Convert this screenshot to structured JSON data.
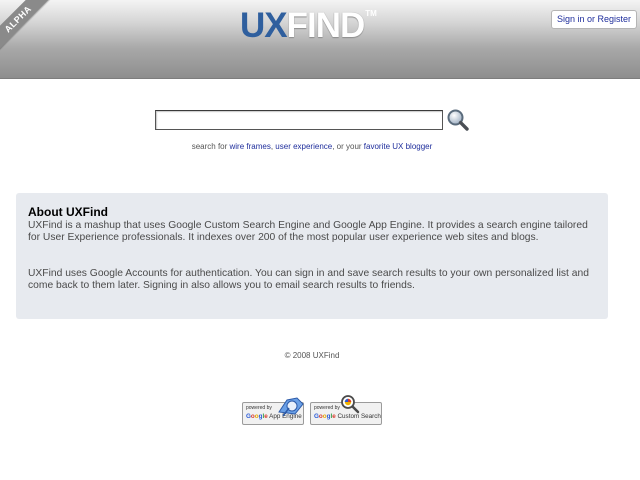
{
  "header": {
    "ribbon": "ALPHA",
    "logo_ux": "UX",
    "logo_find": "FIND",
    "logo_tm": "TM",
    "signin_label": "Sign in or Register"
  },
  "search": {
    "input_value": "",
    "hint_prefix": "search for ",
    "hint_link1": "wire frames",
    "hint_sep1": ", ",
    "hint_link2": "user experience",
    "hint_sep2": ", or your ",
    "hint_link3": "favorite UX blogger",
    "button_icon": "magnifier-icon"
  },
  "about": {
    "title": "About UXFind",
    "paragraph1": "UXFind is a mashup that uses Google Custom Search Engine and Google App Engine. It provides a search engine tailored for User Experience professionals. It indexes over 200 of the most popular user experience web sites and blogs.",
    "paragraph2": "UXFind uses Google Accounts for authentication. You can sign in and save search results to your own personalized list and come back to them later. Signing in also allows you to email search results to friends."
  },
  "footer": {
    "copyright": "© 2008 UXFind",
    "badge_appengine_powered": "powered by",
    "badge_appengine_name": "App Engine",
    "badge_cse_powered": "powered by",
    "badge_cse_name": "Custom Search",
    "google_g": "G",
    "google_o1": "o",
    "google_o2": "o",
    "google_g2": "g",
    "google_l": "l",
    "google_e": "e"
  },
  "colors": {
    "accent_blue": "#2f5f9e",
    "link": "#1f2e9c",
    "panel_bg": "#e7eaef"
  }
}
